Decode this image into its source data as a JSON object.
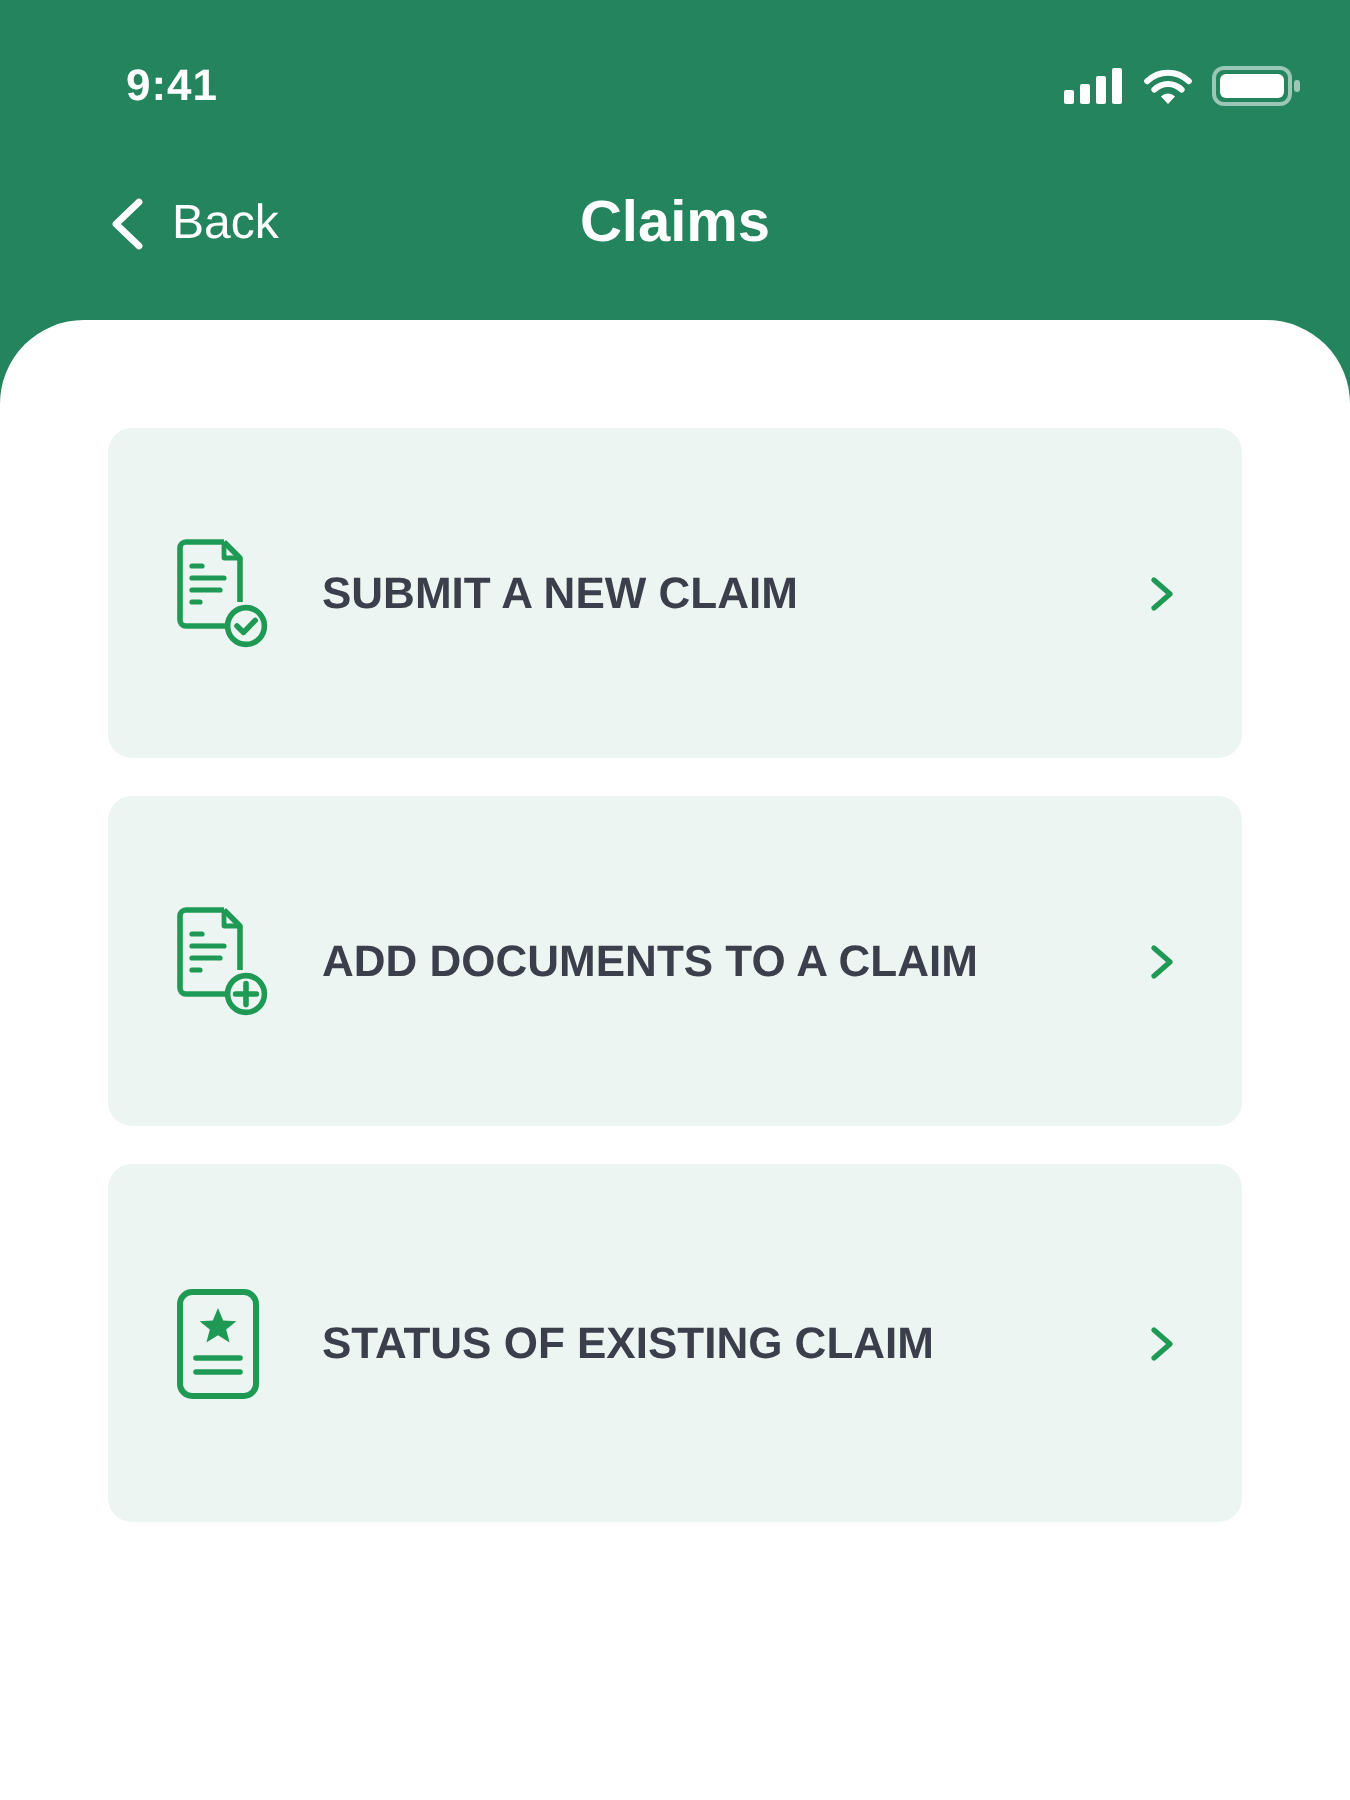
{
  "status_bar": {
    "time": "9:41"
  },
  "nav": {
    "back_label": "Back",
    "title": "Claims"
  },
  "options": [
    {
      "kind": "submit",
      "label": "SUBMIT A NEW CLAIM"
    },
    {
      "kind": "add",
      "label": "ADD DOCUMENTS TO A CLAIM"
    },
    {
      "kind": "status",
      "label": "STATUS OF EXISTING CLAIM"
    }
  ]
}
